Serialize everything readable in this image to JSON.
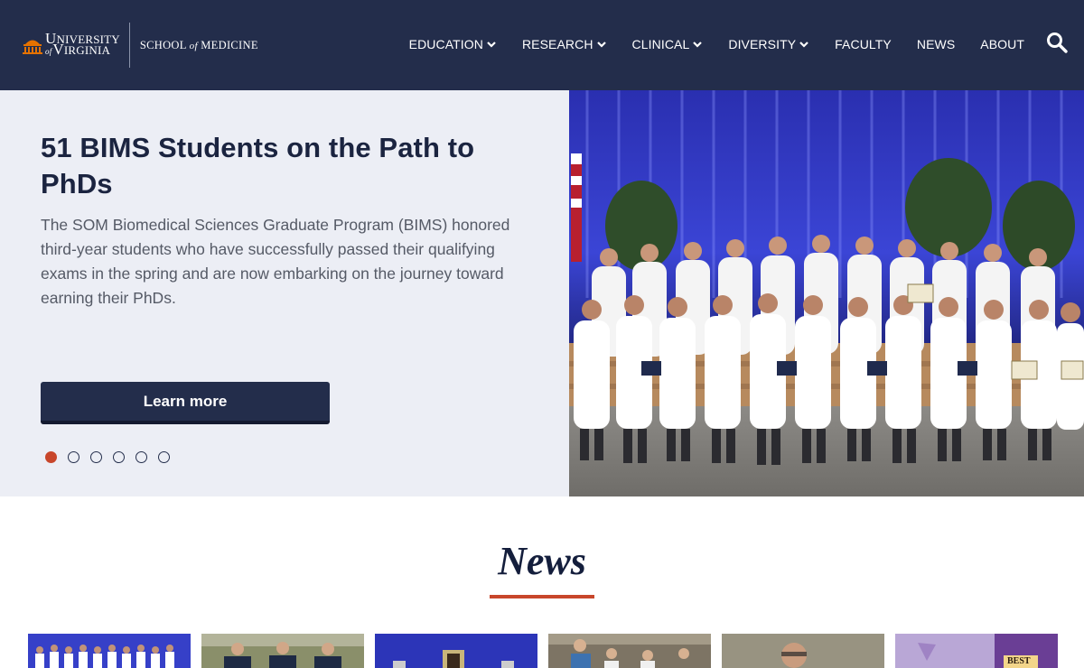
{
  "header": {
    "logo": {
      "university_line1": "UNIVERSITY",
      "university_line2": "VIRGINIA",
      "university_of": "of",
      "school_pre": "SCHOOL",
      "school_of": "of",
      "school_post": "MEDICINE"
    },
    "nav": [
      {
        "label": "EDUCATION",
        "dropdown": true
      },
      {
        "label": "RESEARCH",
        "dropdown": true
      },
      {
        "label": "CLINICAL",
        "dropdown": true
      },
      {
        "label": "DIVERSITY",
        "dropdown": true
      },
      {
        "label": "FACULTY",
        "dropdown": false
      },
      {
        "label": "NEWS",
        "dropdown": false
      },
      {
        "label": "ABOUT",
        "dropdown": false
      }
    ],
    "search_icon": "search-icon"
  },
  "hero": {
    "title": "51 BIMS Students on the Path to PhDs",
    "body": "The SOM Biomedical Sciences Graduate Program (BIMS) honored third-year students who have successfully passed their qualifying exams in the spring and are now embarking on the journey toward earning their PhDs.",
    "button_label": "Learn more",
    "slide_count": 6,
    "active_slide": 1
  },
  "news": {
    "heading": "News",
    "thumb_text_6": "BEST"
  },
  "colors": {
    "navy": "#232d4b",
    "accent_orange": "#c8462b",
    "hero_bg": "#eceef5"
  }
}
